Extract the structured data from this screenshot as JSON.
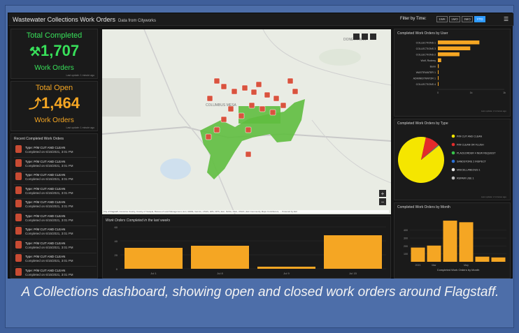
{
  "window": {
    "title": "Wastewater Collections Work Orders",
    "subtitle": "Data from Cityworks",
    "filter_label": "Filter by Time:",
    "filter_buttons": [
      "1WK",
      "1MO",
      "3MO",
      "YTD"
    ],
    "filter_selected": "YTD"
  },
  "kpis": {
    "completed": {
      "title": "Total Completed",
      "value": "1,707",
      "label": "Work Orders",
      "foot": "Last update: 1 minute ago",
      "color": "#38e05a"
    },
    "open": {
      "title": "Total Open",
      "value": "1,464",
      "label": "Work Orders",
      "foot": "Last update: 1 minute ago",
      "color": "#f5a623"
    }
  },
  "recent": {
    "title": "Recent Completed Work Orders",
    "items": [
      {
        "type": "Type: P/M CUT AND CLEAN",
        "completed": "Completed on 6/15/2021, 3:01 PM"
      },
      {
        "type": "Type: P/M CUT AND CLEAN",
        "completed": "Completed on 6/15/2021, 3:01 PM"
      },
      {
        "type": "Type: P/M CUT AND CLEAN",
        "completed": "Completed on 6/15/2021, 3:01 PM"
      },
      {
        "type": "Type: P/M CUT AND CLEAN",
        "completed": "Completed on 6/15/2021, 3:01 PM"
      },
      {
        "type": "Type: P/M CUT AND CLEAN",
        "completed": "Completed on 6/15/2021, 3:01 PM"
      },
      {
        "type": "Type: P/M CUT AND CLEAN",
        "completed": "Completed on 6/15/2021, 3:01 PM"
      },
      {
        "type": "Type: P/M CUT AND CLEAN",
        "completed": "Completed on 6/15/2021, 3:01 PM"
      },
      {
        "type": "Type: P/M CUT AND CLEAN",
        "completed": "Completed on 6/15/2021, 3:01 PM"
      },
      {
        "type": "Type: P/M CUT AND CLEAN",
        "completed": "Completed on 6/15/2021, 3:01 PM"
      },
      {
        "type": "Type: P/M CUT AND CLEAN",
        "completed": "Completed on 6/15/2021, 3:01 PM"
      }
    ]
  },
  "map": {
    "labels": [
      "DONEY PARK",
      "COLUMBUS MESA"
    ],
    "attribution": "City of Flagstaff, Coconino County, County of Yavapai, Bureau of Land Management, Esri, HERE, Garmin, USGS, EPA, NPS | Esri, NASA, NGA, USGS | Esri Community Maps Contributors, ... Powered by Esri"
  },
  "chart_data": [
    {
      "type": "bar",
      "title": "Completed Work Orders by User",
      "orientation": "horizontal",
      "categories": [
        "COLLECTIONS 1",
        "COLLECTIONS 3",
        "COLLECTIONS 2",
        "Wolf, Rodney",
        "Bunn",
        "WASTEWATER 1",
        "ADMINISTRATOR 1",
        "COLLECTIONS 4"
      ],
      "values": [
        500,
        390,
        260,
        40,
        10,
        8,
        5,
        3
      ],
      "ticks": [
        "0",
        "1k",
        "1k"
      ],
      "foot": "Last update: 2 minutes ago",
      "color": "#f5a623"
    },
    {
      "type": "pie",
      "title": "Completed Work Orders by Type",
      "slices": [
        {
          "label": "P/M CUT AND CLEAN",
          "value": 1520,
          "color": "#f5e600"
        },
        {
          "label": "P/M CLEAN OR FLUSH",
          "value": 175,
          "color": "#e32b2b"
        },
        {
          "label": "PLACEORDER 4 NEW REQUEST",
          "value": 5,
          "color": "#38c44a"
        },
        {
          "label": "SANDSTORE 2 INSPECT",
          "value": 3,
          "color": "#2b72d8"
        },
        {
          "label": "MISCELLANEOUS 1",
          "value": 2,
          "color": "#e6e6e6"
        },
        {
          "label": "REPAIR USE 1",
          "value": 2,
          "color": "#bdbdbd"
        }
      ],
      "foot": "Last update: 2 minutes ago"
    },
    {
      "type": "bar",
      "title": "Work Orders Completed in the last weeks",
      "categories": [
        "Jul 1",
        "Jul 8",
        "Jul 9",
        "Jul 15"
      ],
      "values": [
        30,
        33,
        3,
        48
      ],
      "ylim": [
        0,
        60
      ],
      "yticks": [
        "60",
        "40",
        "20",
        "0"
      ],
      "color": "#f5a623"
    },
    {
      "type": "bar",
      "title": "Completed Work Orders by Month",
      "categories": [
        "2021",
        "Mar",
        "",
        "May",
        "",
        ""
      ],
      "values": [
        180,
        205,
        520,
        500,
        65,
        55
      ],
      "ylim": [
        0,
        600
      ],
      "yticks": [
        "400",
        "300",
        "200",
        "100"
      ],
      "xlabel": "Completed Work Orders by Month",
      "color": "#f5a623"
    }
  ],
  "caption": "A Collections dashboard, showing open and closed work orders around Flagstaff."
}
